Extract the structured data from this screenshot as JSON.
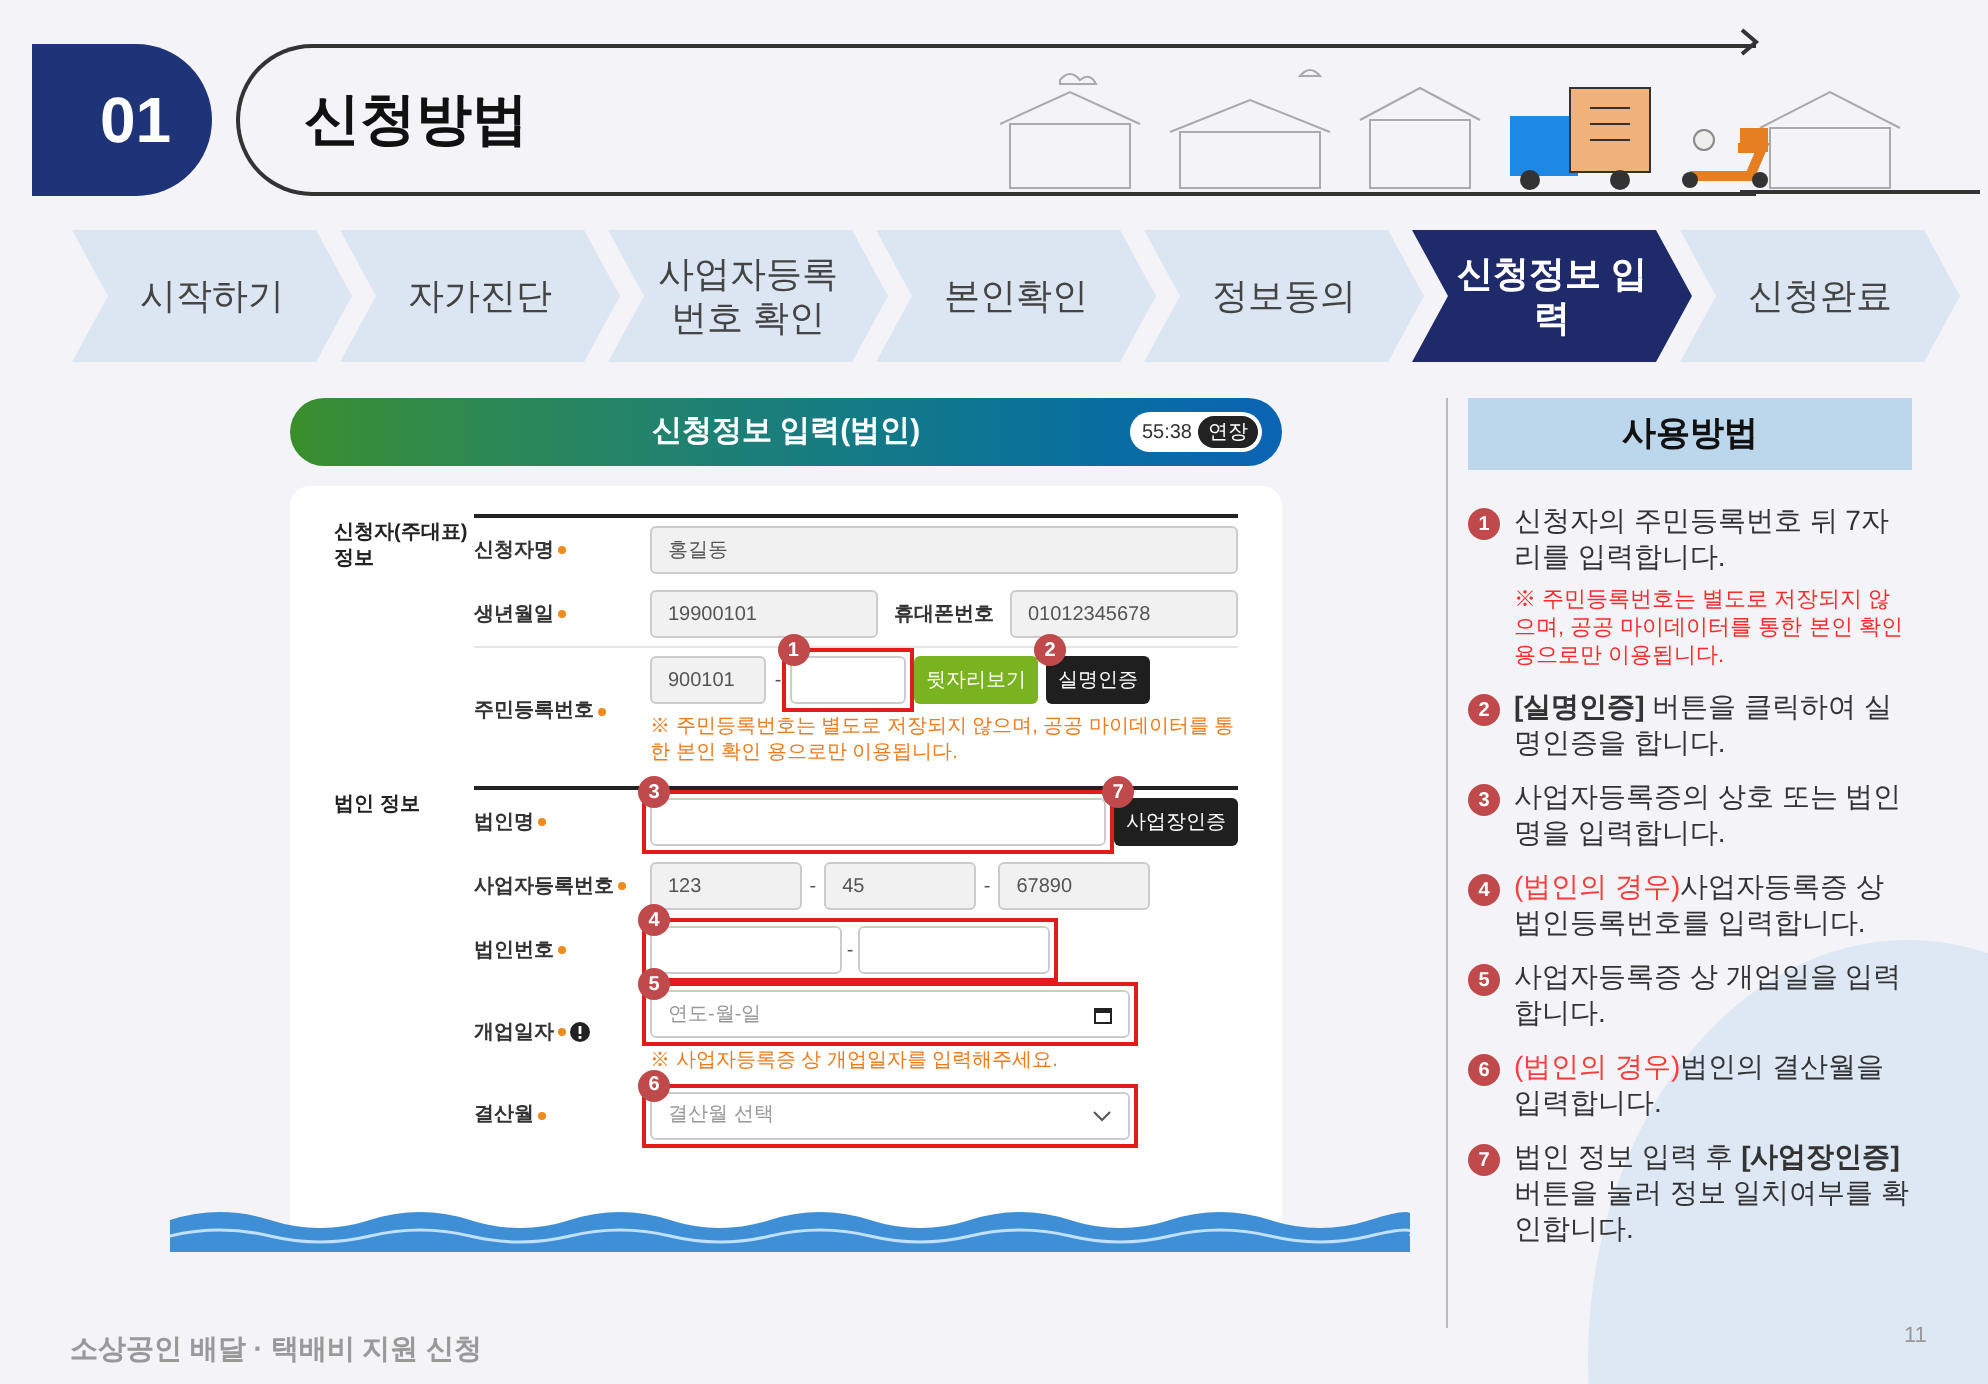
{
  "header": {
    "number": "01",
    "title": "신청방법"
  },
  "steps": [
    {
      "label": "시작하기",
      "selected": false
    },
    {
      "label": "자가진단",
      "selected": false
    },
    {
      "label": "사업자등록 번호 확인",
      "selected": false
    },
    {
      "label": "본인확인",
      "selected": false
    },
    {
      "label": "정보동의",
      "selected": false
    },
    {
      "label": "신청정보 입력",
      "selected": true
    },
    {
      "label": "신청완료",
      "selected": false
    }
  ],
  "form": {
    "title": "신청정보 입력(법인)",
    "timer": "55:38",
    "extend_button": "연장",
    "sections": [
      {
        "heading": "신청자(주대표) 정보",
        "rows": [
          {
            "kind": "wide",
            "label": "신청자명",
            "required": true,
            "parts": [
              {
                "kind": "input",
                "value": "홍길동"
              }
            ]
          },
          {
            "kind": "wide",
            "label": "생년월일",
            "required": true,
            "parts": [
              {
                "kind": "input",
                "value": "19900101"
              },
              {
                "kind": "label",
                "text": "휴대폰번호"
              },
              {
                "kind": "input",
                "value": "01012345678"
              }
            ]
          },
          {
            "kind": "short",
            "label": "주민등록번호",
            "required": true,
            "parts": [
              {
                "kind": "input",
                "value": "900101"
              },
              {
                "kind": "sep",
                "text": "-"
              },
              {
                "kind": "input",
                "marker": "1"
              },
              {
                "kind": "green_button",
                "text": "뒷자리보기"
              },
              {
                "kind": "dark_button",
                "text": "실명인증",
                "marker": "2"
              }
            ],
            "note": "※ 주민등록번호는 별도로 저장되지 않으며, 공공 마이데이터를 통한 본인 확인 용으로만 이용됩니다."
          }
        ]
      },
      {
        "heading": "법인 정보",
        "rows": [
          {
            "kind": "wide",
            "label": "법인명",
            "required": true,
            "parts": [
              {
                "kind": "input",
                "marker": "3"
              },
              {
                "kind": "dark_button",
                "text": "사업장인증",
                "marker": "7"
              }
            ]
          },
          {
            "kind": "short",
            "label": "사업자등록번호",
            "required": true,
            "parts": [
              {
                "kind": "input",
                "value": "123"
              },
              {
                "kind": "sep",
                "text": "-"
              },
              {
                "kind": "input",
                "value": "45"
              },
              {
                "kind": "sep",
                "text": "-"
              },
              {
                "kind": "input",
                "value": "67890"
              }
            ]
          },
          {
            "kind": "short",
            "label": "법인번호",
            "required": true,
            "parts": [
              {
                "kind": "group",
                "marker": "4",
                "parts": [
                  {
                    "kind": "input"
                  },
                  {
                    "kind": "sep",
                    "text": "-"
                  },
                  {
                    "kind": "input"
                  }
                ]
              }
            ]
          },
          {
            "kind": "short",
            "label": "개업일자",
            "required": true,
            "info": true,
            "parts": [
              {
                "kind": "date",
                "placeholder": "연도-월-일",
                "marker": "5"
              }
            ],
            "note": "※ 사업자등록증 상 개업일자를 입력해주세요."
          },
          {
            "kind": "short",
            "label": "결산월",
            "required": true,
            "parts": [
              {
                "kind": "select",
                "placeholder": "결산월 선택",
                "marker": "6"
              }
            ]
          }
        ]
      }
    ]
  },
  "guide": {
    "title": "사용방법",
    "items": [
      {
        "number": "1",
        "text": "신청자의 주민등록번호 뒤 7자리를 입력합니다.",
        "note": "※ 주민등록번호는 별도로 저장되지 않으며, 공공 마이데이터를 통한 본인 확인 용으로만 이용됩니다."
      },
      {
        "number": "2",
        "text": "**[실명인증]** 버튼을 클릭하여 실명인증을 합니다."
      },
      {
        "number": "3",
        "text": "사업자등록증의 상호 또는 법인명을 입력합니다."
      },
      {
        "number": "4",
        "prefix": "(법인의 경우)",
        "text": "사업자등록증 상 법인등록번호를 입력합니다."
      },
      {
        "number": "5",
        "text": "사업자등록증 상 개업일을 입력합니다."
      },
      {
        "number": "6",
        "prefix": "(법인의 경우)",
        "text": "법인의 결산월을 입력합니다."
      },
      {
        "number": "7",
        "text": "법인 정보 입력 후 **[사업장인증]** 버튼을 눌러 정보 일치여부를 확인합니다."
      }
    ]
  },
  "footer": {
    "title": "소상공인 배달 · 택배비 지원 신청",
    "page": "11"
  }
}
